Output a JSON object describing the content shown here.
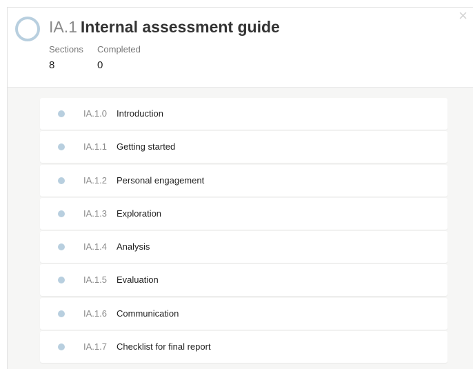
{
  "header": {
    "code": "IA.1",
    "title": "Internal assessment guide",
    "close_symbol": "×",
    "stats": {
      "sections_label": "Sections",
      "sections_value": "8",
      "completed_label": "Completed",
      "completed_value": "0"
    }
  },
  "sections": [
    {
      "number": "IA.1.0",
      "label": "Introduction"
    },
    {
      "number": "IA.1.1",
      "label": "Getting started"
    },
    {
      "number": "IA.1.2",
      "label": "Personal engagement"
    },
    {
      "number": "IA.1.3",
      "label": "Exploration"
    },
    {
      "number": "IA.1.4",
      "label": "Analysis"
    },
    {
      "number": "IA.1.5",
      "label": "Evaluation"
    },
    {
      "number": "IA.1.6",
      "label": "Communication"
    },
    {
      "number": "IA.1.7",
      "label": "Checklist for final report"
    }
  ],
  "colors": {
    "accent": "#b8cfdf",
    "page_background": "#f6f6f5"
  },
  "icons": {
    "progress": "progress-ring-icon",
    "close": "close-icon",
    "status": "status-dot-icon"
  }
}
